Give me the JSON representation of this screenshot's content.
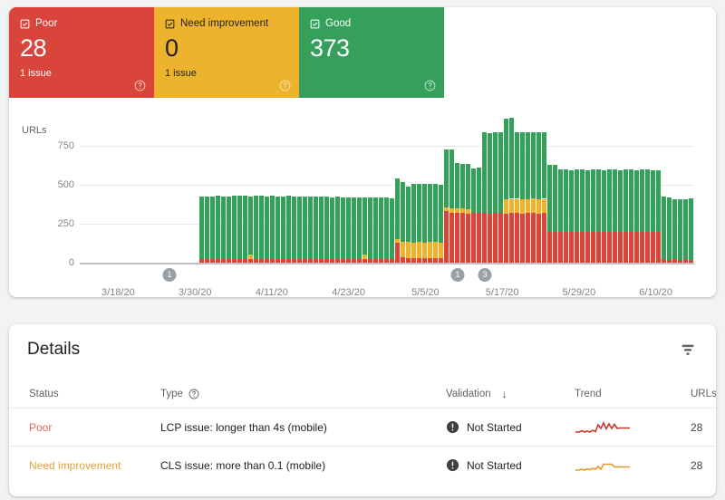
{
  "summary": {
    "cards": [
      {
        "id": "poor",
        "label": "Poor",
        "value": "28",
        "sub": "1 issue",
        "checkbox": "checkbox-checked-icon",
        "help": "help-icon",
        "color": "#d9453a"
      },
      {
        "id": "need-improvement",
        "label": "Need improvement",
        "value": "0",
        "sub": "1 issue",
        "checkbox": "checkbox-checked-icon",
        "help": "help-icon",
        "color": "#eeb32d"
      },
      {
        "id": "good",
        "label": "Good",
        "value": "373",
        "sub": "",
        "checkbox": "checkbox-checked-icon",
        "help": "help-icon",
        "color": "#34a05c"
      }
    ]
  },
  "chart_data": {
    "type": "bar",
    "stacked": true,
    "title": "",
    "ylabel": "URLs",
    "xlabel": "",
    "ylim": [
      0,
      750
    ],
    "yticks": [
      0,
      250,
      500,
      750
    ],
    "ytick_labels": [
      "0",
      "250",
      "500",
      "750"
    ],
    "xtick_labels": [
      "3/18/20",
      "3/30/20",
      "4/11/20",
      "4/23/20",
      "5/5/20",
      "5/17/20",
      "5/29/20",
      "6/10/20"
    ],
    "grid": true,
    "legend": "none",
    "colors": {
      "good": "#34a05c",
      "need_improvement": "#eeb32d",
      "poor": "#d9453a"
    },
    "annotations": [
      {
        "label": "1",
        "x_index": 16
      },
      {
        "label": "1",
        "x_index": 69
      },
      {
        "label": "3",
        "x_index": 74
      }
    ],
    "series": [
      {
        "name": "Poor",
        "key": "poor",
        "color": "#d9453a",
        "values": [
          0,
          0,
          0,
          0,
          0,
          0,
          0,
          0,
          0,
          0,
          0,
          0,
          0,
          0,
          0,
          0,
          0,
          0,
          0,
          0,
          0,
          0,
          25,
          23,
          24,
          26,
          25,
          23,
          24,
          25,
          26,
          24,
          23,
          25,
          24,
          26,
          25,
          23,
          24,
          25,
          26,
          24,
          25,
          23,
          24,
          26,
          25,
          24,
          23,
          25,
          26,
          24,
          23,
          25,
          24,
          26,
          25,
          24,
          130,
          33,
          30,
          28,
          32,
          30,
          29,
          31,
          30,
          330,
          320,
          318,
          322,
          316,
          320,
          318,
          320,
          316,
          318,
          320,
          316,
          318,
          320,
          316,
          318,
          320,
          316,
          318,
          200,
          198,
          200,
          196,
          198,
          200,
          198,
          196,
          200,
          198,
          196,
          200,
          198,
          196,
          200,
          198,
          196,
          200,
          198,
          196,
          198,
          22,
          20,
          22,
          20,
          22,
          20
        ]
      },
      {
        "name": "Need improvement",
        "key": "need_improvement",
        "color": "#eeb32d",
        "values": [
          0,
          0,
          0,
          0,
          0,
          0,
          0,
          0,
          0,
          0,
          0,
          0,
          0,
          0,
          0,
          0,
          0,
          0,
          0,
          0,
          0,
          0,
          0,
          0,
          0,
          0,
          0,
          0,
          0,
          0,
          0,
          28,
          0,
          0,
          0,
          0,
          0,
          0,
          0,
          0,
          0,
          0,
          0,
          0,
          0,
          0,
          0,
          0,
          0,
          0,
          0,
          0,
          28,
          0,
          0,
          0,
          0,
          0,
          22,
          100,
          102,
          100,
          102,
          100,
          104,
          102,
          100,
          25,
          30,
          32,
          28,
          30,
          0,
          0,
          0,
          0,
          0,
          0,
          90,
          92,
          90,
          92,
          90,
          92,
          90,
          92,
          0,
          0,
          0,
          0,
          0,
          0,
          0,
          0,
          0,
          0,
          0,
          0,
          0,
          0,
          0,
          0,
          0,
          0,
          0,
          0,
          0,
          0,
          0,
          0,
          0,
          0,
          0
        ]
      },
      {
        "name": "Good",
        "key": "good",
        "color": "#34a05c",
        "values": [
          0,
          0,
          0,
          0,
          0,
          0,
          0,
          0,
          0,
          0,
          0,
          0,
          0,
          0,
          0,
          0,
          0,
          0,
          0,
          0,
          0,
          0,
          400,
          402,
          400,
          404,
          402,
          400,
          405,
          403,
          402,
          375,
          405,
          403,
          400,
          402,
          400,
          404,
          406,
          402,
          400,
          403,
          398,
          400,
          402,
          398,
          396,
          400,
          398,
          396,
          394,
          392,
          370,
          395,
          393,
          390,
          392,
          390,
          388,
          386,
          355,
          375,
          372,
          374,
          372,
          374,
          372,
          374,
          376,
          290,
          285,
          288,
          286,
          290,
          520,
          518,
          520,
          516,
          518,
          520,
          430,
          428,
          430,
          428,
          430,
          428,
          430,
          428,
          400,
          402,
          398,
          400,
          402,
          400,
          398,
          402,
          400,
          398,
          402,
          400,
          398,
          402,
          400,
          398,
          402,
          400,
          398,
          402,
          400,
          385,
          388,
          386,
          390,
          388,
          386
        ]
      }
    ]
  },
  "details": {
    "title": "Details",
    "filter_icon": "filter-icon",
    "columns": [
      {
        "key": "status",
        "label": "Status"
      },
      {
        "key": "type",
        "label": "Type",
        "help": "help-icon"
      },
      {
        "key": "validation",
        "label": "Validation",
        "sort": "↓"
      },
      {
        "key": "trend",
        "label": "Trend"
      },
      {
        "key": "urls",
        "label": "URLs"
      }
    ],
    "rows": [
      {
        "status": "Poor",
        "status_color": "#e0675c",
        "type": "LCP issue: longer than 4s (mobile)",
        "validation": "Not Started",
        "validation_icon": "warning-circle-icon",
        "trend_color": "#c5372c",
        "urls": "28"
      },
      {
        "status": "Need improvement",
        "status_color": "#e7a13c",
        "type": "CLS issue: more than 0.1 (mobile)",
        "validation": "Not Started",
        "validation_icon": "warning-circle-icon",
        "trend_color": "#e8962d",
        "urls": "28"
      }
    ]
  }
}
